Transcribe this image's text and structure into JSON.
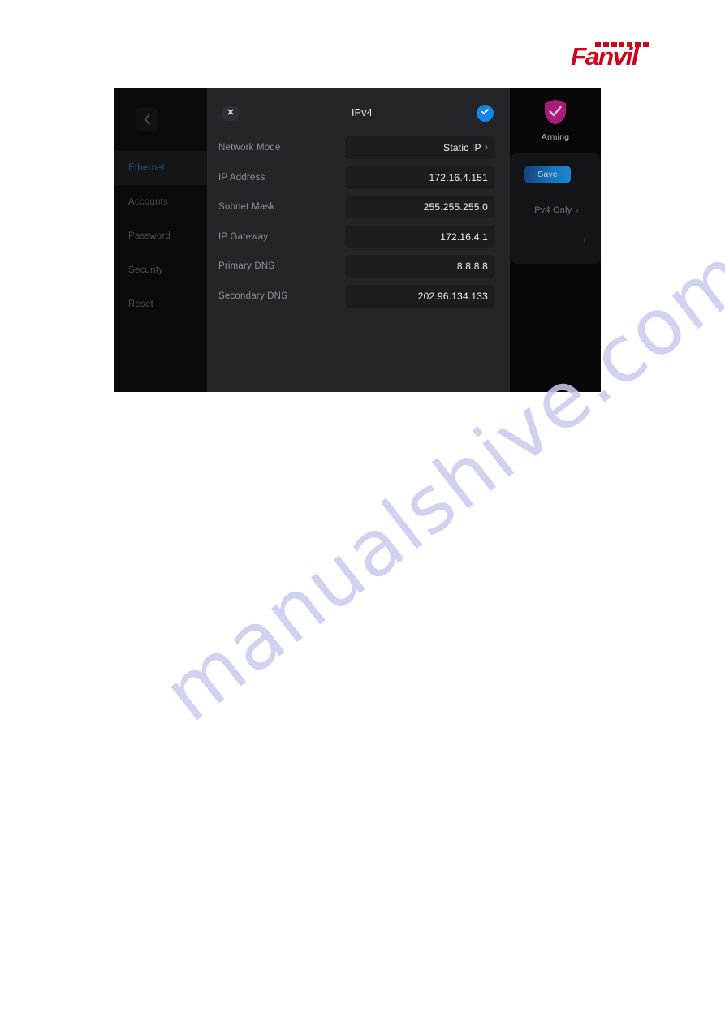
{
  "brand": {
    "logo_text": "Fanvil",
    "logo_color": "#d0021b",
    "dash_count": 7
  },
  "watermark": {
    "text": "manualshive.com"
  },
  "device": {
    "sidebar": {
      "back_icon": "chevron-left-icon",
      "items": [
        {
          "label": "Ethernet",
          "active": true
        },
        {
          "label": "Accounts",
          "active": false
        },
        {
          "label": "Password",
          "active": false
        },
        {
          "label": "Security",
          "active": false
        },
        {
          "label": "Reset",
          "active": false
        }
      ],
      "active_color": "#1e4f7a"
    },
    "dialog": {
      "title": "IPv4",
      "close_icon": "close-icon",
      "close_label": "✕",
      "confirm_icon": "check-circle-icon",
      "confirm_color": "#1387e8",
      "rows": [
        {
          "label": "Network Mode",
          "value": "Static IP",
          "chevron": true
        },
        {
          "label": "IP Address",
          "value": "172.16.4.151",
          "chevron": false
        },
        {
          "label": "Subnet Mask",
          "value": "255.255.255.0",
          "chevron": false
        },
        {
          "label": "IP Gateway",
          "value": "172.16.4.1",
          "chevron": false
        },
        {
          "label": "Primary DNS",
          "value": "8.8.8.8",
          "chevron": false
        },
        {
          "label": "Secondary DNS",
          "value": "202.96.134.133",
          "chevron": false
        }
      ]
    },
    "right_panel": {
      "arming_icon": "shield-check-icon",
      "arming_label": "Arming",
      "arming_color": "#a61e79",
      "save_label": "Save",
      "save_color": "#1572b8",
      "ip_mode_label": "IPv4 Only",
      "ip_mode_chevron": "›",
      "extra_row_chevron": "›"
    }
  }
}
